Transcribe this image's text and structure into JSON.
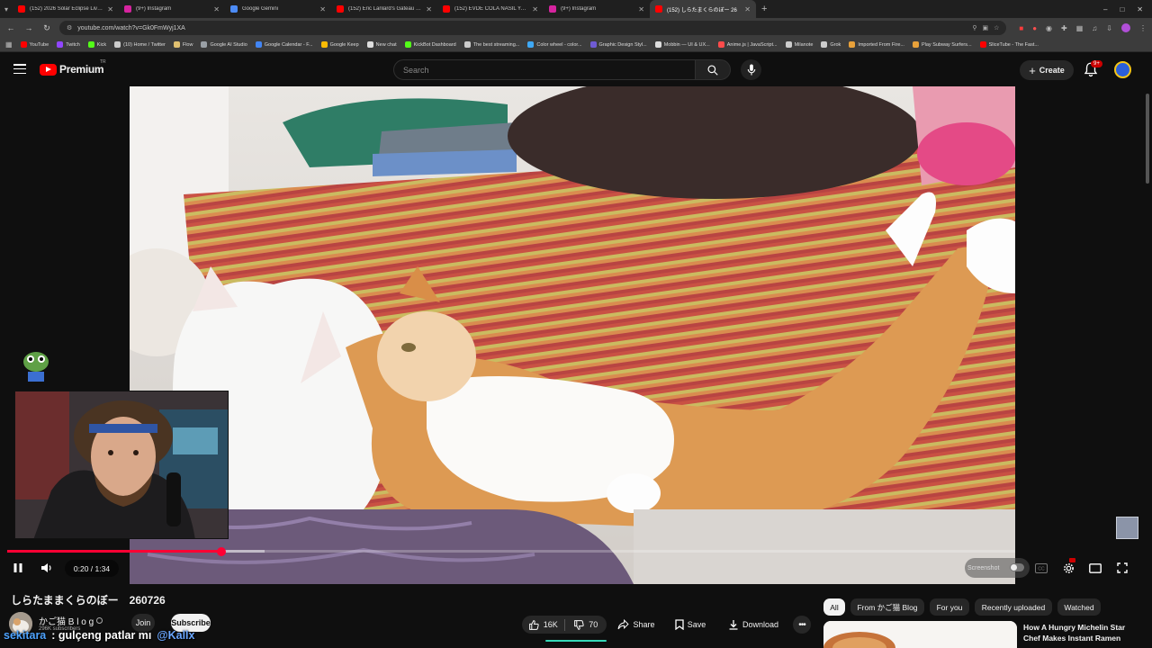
{
  "browser": {
    "tabs": [
      {
        "title": "(152) 2026 Solar Eclipse Live fro",
        "color": "#ff0000"
      },
      {
        "title": "(9+) Instagram",
        "color": "#d6249f"
      },
      {
        "title": "Google Gemini",
        "color": "#4c8bf5"
      },
      {
        "title": "(152) Eric Lanlard's Gateau St. H",
        "color": "#ff0000"
      },
      {
        "title": "(152) EVDE COLA NASIL YAPILIR",
        "color": "#ff0000"
      },
      {
        "title": "(9+) Instagram",
        "color": "#d6249f"
      },
      {
        "title": "(152) しらたまくらのぼー 26",
        "color": "#ff0000"
      }
    ],
    "active_tab": 6,
    "url": "youtube.com/watch?v=Gk0FmWyj1XA",
    "bookmarks": [
      {
        "label": "YouTube",
        "color": "#ff0000"
      },
      {
        "label": "Twitch",
        "color": "#9146ff"
      },
      {
        "label": "Kick",
        "color": "#53fc18"
      },
      {
        "label": "(10) Home / Twitter",
        "color": "#cccccc"
      },
      {
        "label": "Flow",
        "color": "#e0c070"
      },
      {
        "label": "Google AI Studio",
        "color": "#9aa0a6"
      },
      {
        "label": "Google Calendar - F...",
        "color": "#4285f4"
      },
      {
        "label": "Google Keep",
        "color": "#fbbc04"
      },
      {
        "label": "New chat",
        "color": "#dddddd"
      },
      {
        "label": "KickBot Dashboard",
        "color": "#53fc18"
      },
      {
        "label": "The best streaming...",
        "color": "#cccccc"
      },
      {
        "label": "Color wheel - color...",
        "color": "#3fa9f5"
      },
      {
        "label": "Graphic Design Styl...",
        "color": "#6f5bd3"
      },
      {
        "label": "Mobbin — UI & UX...",
        "color": "#dddddd"
      },
      {
        "label": "Anime.js | JavaScript...",
        "color": "#ff4b4b"
      },
      {
        "label": "Milanote",
        "color": "#cccccc"
      },
      {
        "label": "Grok",
        "color": "#cccccc"
      },
      {
        "label": "Imported From Fire...",
        "color": "#e8a13a"
      },
      {
        "label": "Play Subway Surfers...",
        "color": "#e8a13a"
      },
      {
        "label": "SliceTube - The Fast...",
        "color": "#ff0000"
      }
    ]
  },
  "youtube": {
    "brand": "Premium",
    "region": "TR",
    "search_placeholder": "Search",
    "create_label": "Create",
    "notifications": "9+"
  },
  "player": {
    "time": "0:20 / 1:34",
    "progress": 0.2128,
    "buffered": 0.255,
    "screenshot_label": "Screenshot"
  },
  "video": {
    "title": "しらたままくらのぼー　260726",
    "channel": "かご猫 B l o g",
    "subscribers": "296K subscribers",
    "join_label": "Join",
    "subscribe_label": "Subscribe",
    "likes": "16K",
    "dislikes": "70",
    "share_label": "Share",
    "save_label": "Save",
    "download_label": "Download"
  },
  "filters": [
    "All",
    "From かご猫 Blog",
    "For you",
    "Recently uploaded",
    "Watched"
  ],
  "recommendation": {
    "title": "How A Hungry Michelin Star Chef Makes Instant Ramen"
  },
  "chat_overlay": {
    "user": "sekitara",
    "message": ": gulçeng patlar mı",
    "mention": "@Kallx"
  },
  "colors": {
    "brand_red": "#ff0000",
    "progress_red": "#ff0033",
    "background": "#0f0f0f"
  }
}
